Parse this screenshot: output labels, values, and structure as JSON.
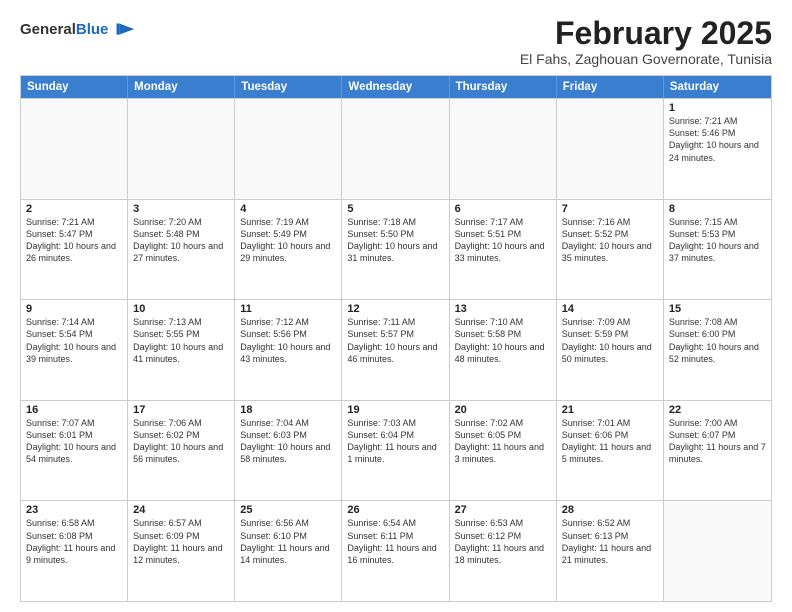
{
  "logo": {
    "general": "General",
    "blue": "Blue"
  },
  "title": "February 2025",
  "subtitle": "El Fahs, Zaghouan Governorate, Tunisia",
  "calendar": {
    "headers": [
      "Sunday",
      "Monday",
      "Tuesday",
      "Wednesday",
      "Thursday",
      "Friday",
      "Saturday"
    ],
    "rows": [
      [
        {
          "day": "",
          "empty": true
        },
        {
          "day": "",
          "empty": true
        },
        {
          "day": "",
          "empty": true
        },
        {
          "day": "",
          "empty": true
        },
        {
          "day": "",
          "empty": true
        },
        {
          "day": "",
          "empty": true
        },
        {
          "day": "1",
          "sunrise": "7:21 AM",
          "sunset": "5:46 PM",
          "daylight": "10 hours and 24 minutes."
        }
      ],
      [
        {
          "day": "2",
          "sunrise": "7:21 AM",
          "sunset": "5:47 PM",
          "daylight": "10 hours and 26 minutes."
        },
        {
          "day": "3",
          "sunrise": "7:20 AM",
          "sunset": "5:48 PM",
          "daylight": "10 hours and 27 minutes."
        },
        {
          "day": "4",
          "sunrise": "7:19 AM",
          "sunset": "5:49 PM",
          "daylight": "10 hours and 29 minutes."
        },
        {
          "day": "5",
          "sunrise": "7:18 AM",
          "sunset": "5:50 PM",
          "daylight": "10 hours and 31 minutes."
        },
        {
          "day": "6",
          "sunrise": "7:17 AM",
          "sunset": "5:51 PM",
          "daylight": "10 hours and 33 minutes."
        },
        {
          "day": "7",
          "sunrise": "7:16 AM",
          "sunset": "5:52 PM",
          "daylight": "10 hours and 35 minutes."
        },
        {
          "day": "8",
          "sunrise": "7:15 AM",
          "sunset": "5:53 PM",
          "daylight": "10 hours and 37 minutes."
        }
      ],
      [
        {
          "day": "9",
          "sunrise": "7:14 AM",
          "sunset": "5:54 PM",
          "daylight": "10 hours and 39 minutes."
        },
        {
          "day": "10",
          "sunrise": "7:13 AM",
          "sunset": "5:55 PM",
          "daylight": "10 hours and 41 minutes."
        },
        {
          "day": "11",
          "sunrise": "7:12 AM",
          "sunset": "5:56 PM",
          "daylight": "10 hours and 43 minutes."
        },
        {
          "day": "12",
          "sunrise": "7:11 AM",
          "sunset": "5:57 PM",
          "daylight": "10 hours and 46 minutes."
        },
        {
          "day": "13",
          "sunrise": "7:10 AM",
          "sunset": "5:58 PM",
          "daylight": "10 hours and 48 minutes."
        },
        {
          "day": "14",
          "sunrise": "7:09 AM",
          "sunset": "5:59 PM",
          "daylight": "10 hours and 50 minutes."
        },
        {
          "day": "15",
          "sunrise": "7:08 AM",
          "sunset": "6:00 PM",
          "daylight": "10 hours and 52 minutes."
        }
      ],
      [
        {
          "day": "16",
          "sunrise": "7:07 AM",
          "sunset": "6:01 PM",
          "daylight": "10 hours and 54 minutes."
        },
        {
          "day": "17",
          "sunrise": "7:06 AM",
          "sunset": "6:02 PM",
          "daylight": "10 hours and 56 minutes."
        },
        {
          "day": "18",
          "sunrise": "7:04 AM",
          "sunset": "6:03 PM",
          "daylight": "10 hours and 58 minutes."
        },
        {
          "day": "19",
          "sunrise": "7:03 AM",
          "sunset": "6:04 PM",
          "daylight": "11 hours and 1 minute."
        },
        {
          "day": "20",
          "sunrise": "7:02 AM",
          "sunset": "6:05 PM",
          "daylight": "11 hours and 3 minutes."
        },
        {
          "day": "21",
          "sunrise": "7:01 AM",
          "sunset": "6:06 PM",
          "daylight": "11 hours and 5 minutes."
        },
        {
          "day": "22",
          "sunrise": "7:00 AM",
          "sunset": "6:07 PM",
          "daylight": "11 hours and 7 minutes."
        }
      ],
      [
        {
          "day": "23",
          "sunrise": "6:58 AM",
          "sunset": "6:08 PM",
          "daylight": "11 hours and 9 minutes."
        },
        {
          "day": "24",
          "sunrise": "6:57 AM",
          "sunset": "6:09 PM",
          "daylight": "11 hours and 12 minutes."
        },
        {
          "day": "25",
          "sunrise": "6:56 AM",
          "sunset": "6:10 PM",
          "daylight": "11 hours and 14 minutes."
        },
        {
          "day": "26",
          "sunrise": "6:54 AM",
          "sunset": "6:11 PM",
          "daylight": "11 hours and 16 minutes."
        },
        {
          "day": "27",
          "sunrise": "6:53 AM",
          "sunset": "6:12 PM",
          "daylight": "11 hours and 18 minutes."
        },
        {
          "day": "28",
          "sunrise": "6:52 AM",
          "sunset": "6:13 PM",
          "daylight": "11 hours and 21 minutes."
        },
        {
          "day": "",
          "empty": true
        }
      ]
    ]
  }
}
